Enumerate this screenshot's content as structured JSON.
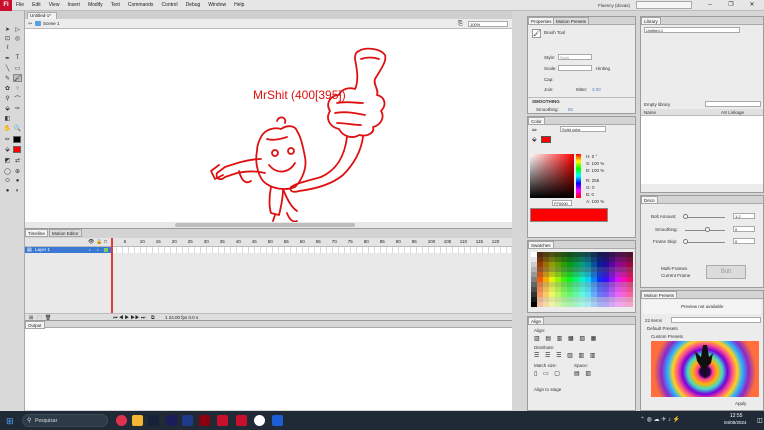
{
  "menubar": {
    "app_icon": "Fl",
    "items": [
      "File",
      "Edit",
      "View",
      "Insert",
      "Modify",
      "Text",
      "Commands",
      "Control",
      "Debug",
      "Window",
      "Help"
    ],
    "workspace": "Fluency (dovas)",
    "window_controls": [
      "–",
      "❐",
      "✕"
    ]
  },
  "document": {
    "tab": "Untitled-1*",
    "scene": "Scene 1",
    "zoom": "100%"
  },
  "stage": {
    "drawing_text": "MrShit (400[395])",
    "stroke_color": "#dd1111"
  },
  "timeline": {
    "tabs": [
      "Timeline",
      "Motion Editor"
    ],
    "layer": "Layer 1",
    "frame_numbers": [
      "1",
      "5",
      "10",
      "15",
      "20",
      "25",
      "30",
      "35",
      "40",
      "45",
      "50",
      "55",
      "60",
      "65",
      "70",
      "75",
      "80",
      "85",
      "90",
      "95",
      "100",
      "105",
      "110",
      "115",
      "120"
    ],
    "footer": "1  24.00 fps  0.0 s"
  },
  "output": {
    "tab": "Output"
  },
  "properties": {
    "tabs": [
      "Properties",
      "Motion Presets"
    ],
    "tool": "Brush Tool",
    "style_label": "Style:",
    "style_value": "Solid",
    "scale_label": "Scale:",
    "hinting": "Hinting",
    "cap_label": "Cap:",
    "join_label": "Join:",
    "miter_label": "Miter:",
    "miter_value": "3.00",
    "smoothing_section": "SMOOTHING",
    "smoothing_label": "Smoothing:",
    "smoothing_value": "50"
  },
  "color": {
    "tab": "Color",
    "type": "Solid color",
    "h": "H: 0 °",
    "s": "S: 100 %",
    "b": "B: 100 %",
    "r": "R: 255",
    "g": "G: 0",
    "bl": "B: 0",
    "alpha": "A: 100 %",
    "hex": "FF0000",
    "swatch": "#ff0000"
  },
  "swatches": {
    "tab": "Swatches"
  },
  "align": {
    "tab": "Align",
    "align_label": "Align:",
    "distribute_label": "Distribute:",
    "match_label": "Match size:",
    "space_label": "Space:",
    "stage_label": "Align to stage"
  },
  "library": {
    "tab": "Library",
    "document": "Untitled-1",
    "empty": "Empty library",
    "col_name": "Name",
    "col_linkage": "AS Linkage"
  },
  "deco": {
    "tab": "Deco",
    "bolt_amount": "Bolt Amount:",
    "bolt_amount_value": "1.2",
    "smoothing": "Smoothing:",
    "smoothing_value": "0",
    "frame_skip": "Frame Skip:",
    "frame_skip_value": "0",
    "multi_frames": "Multi-Frames",
    "current_frame": "Current Frame",
    "bolt_button": "Bolt"
  },
  "motion_presets": {
    "tab": "Motion Presets",
    "preview": "Preview not available",
    "count": "22 items",
    "default": "Default Presets",
    "custom": "Custom Presets",
    "apply": "Apply"
  },
  "taskbar": {
    "search": "Pesquisar",
    "time": "12:55",
    "date": "04/08/2024"
  }
}
